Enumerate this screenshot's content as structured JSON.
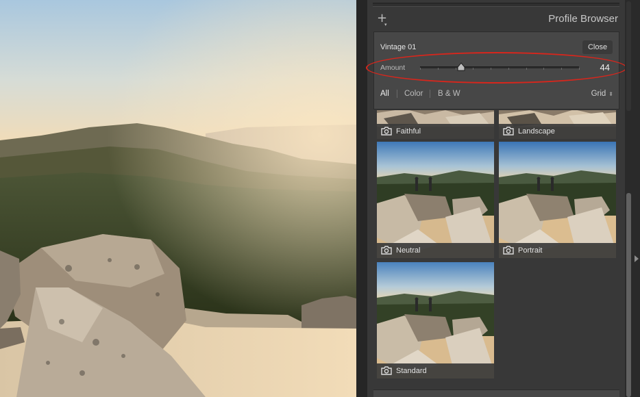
{
  "panel": {
    "title": "Profile Browser",
    "add_symbol": "+",
    "add_caret": "▾"
  },
  "profile": {
    "name": "Vintage 01",
    "close_label": "Close",
    "amount_label": "Amount",
    "amount_value": "44",
    "amount_fraction": 0.26
  },
  "filters": {
    "items": [
      "All",
      "Color",
      "B & W"
    ],
    "active": "All",
    "view_label": "Grid",
    "view_arrows": "⬍"
  },
  "grid": {
    "items": [
      {
        "label": "Faithful"
      },
      {
        "label": "Landscape"
      },
      {
        "label": "Neutral"
      },
      {
        "label": "Portrait"
      },
      {
        "label": "Standard"
      }
    ]
  },
  "colors": {
    "highlight": "#d8261c",
    "panel_bg": "#383838",
    "box_bg": "#474747"
  },
  "icons": {
    "add": "plus-icon",
    "camera": "camera-icon",
    "updown": "updown-arrows-icon",
    "slider_thumb": "slider-thumb-icon",
    "collapse": "triangle-right-icon"
  }
}
